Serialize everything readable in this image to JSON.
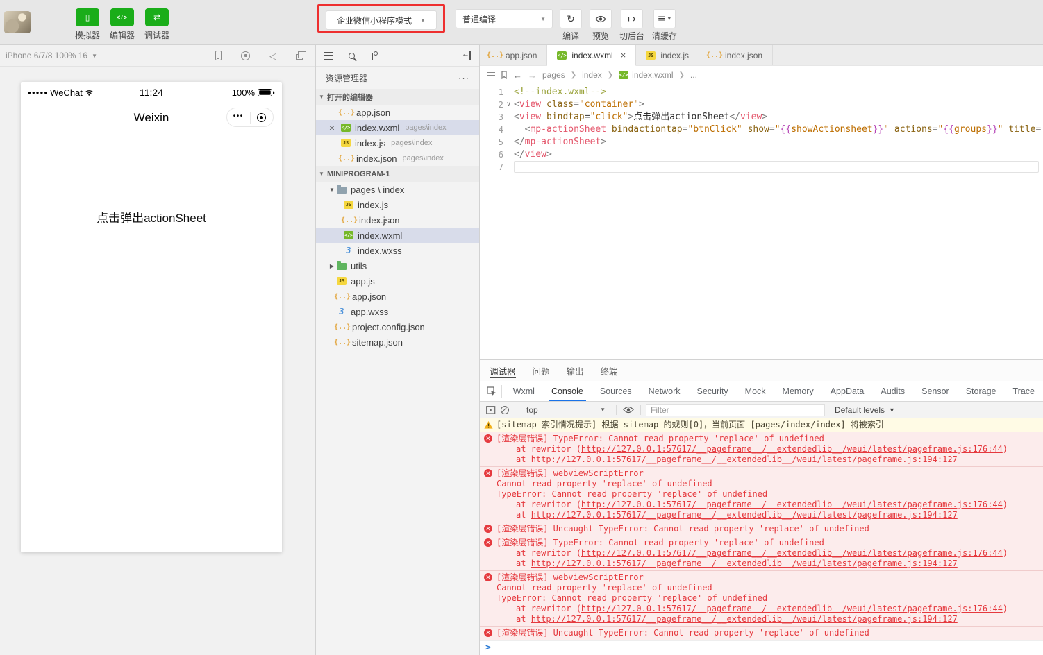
{
  "topbar": {
    "nav": [
      {
        "name": "simulator",
        "label": "模拟器",
        "icon": "phone-icon"
      },
      {
        "name": "editor",
        "label": "编辑器",
        "icon": "code-icon"
      },
      {
        "name": "debugger",
        "label": "调试器",
        "icon": "sliders-icon"
      }
    ],
    "mode_select": {
      "value": "企业微信小程序模式"
    },
    "compile_select": {
      "value": "普通编译"
    },
    "actions": [
      {
        "name": "compile",
        "label": "编译",
        "icon": "refresh-icon",
        "caret": false
      },
      {
        "name": "preview",
        "label": "预览",
        "icon": "eye-icon",
        "caret": false
      },
      {
        "name": "switch-background",
        "label": "切后台",
        "icon": "background-icon",
        "caret": false
      },
      {
        "name": "clear-cache",
        "label": "清缓存",
        "icon": "layers-icon",
        "caret": true
      }
    ]
  },
  "simulator": {
    "device_label": "iPhone 6/7/8 100% 16",
    "toolbar_icons": [
      "rotate-device",
      "record",
      "mute",
      "detach-window"
    ],
    "status": {
      "signal": "●●●●●",
      "carrier": "WeChat",
      "time": "11:24",
      "battery": "100%"
    },
    "nav_title": "Weixin",
    "capsule_dots": "•••",
    "content_text": "点击弹出actionSheet"
  },
  "explorer": {
    "title": "资源管理器",
    "menu_dots": "···",
    "open_editors": {
      "label": "打开的编辑器",
      "items": [
        {
          "icon": "json",
          "name": "app.json",
          "path": ""
        },
        {
          "icon": "wxml",
          "name": "index.wxml",
          "path": "pages\\index",
          "selected": true,
          "closable": true
        },
        {
          "icon": "js",
          "name": "index.js",
          "path": "pages\\index"
        },
        {
          "icon": "json",
          "name": "index.json",
          "path": "pages\\index"
        }
      ]
    },
    "project": {
      "label": "MINIPROGRAM-1",
      "items": [
        {
          "icon": "folder",
          "name": "pages \\ index",
          "depth": 0,
          "arrow": "down"
        },
        {
          "icon": "js",
          "name": "index.js",
          "depth": 1
        },
        {
          "icon": "json",
          "name": "index.json",
          "depth": 1
        },
        {
          "icon": "wxml",
          "name": "index.wxml",
          "depth": 1,
          "selected": true
        },
        {
          "icon": "wxss",
          "name": "index.wxss",
          "depth": 1
        },
        {
          "icon": "folder-green",
          "name": "utils",
          "depth": 0,
          "arrow": "right"
        },
        {
          "icon": "js",
          "name": "app.js",
          "depth": 0
        },
        {
          "icon": "json",
          "name": "app.json",
          "depth": 0
        },
        {
          "icon": "wxss",
          "name": "app.wxss",
          "depth": 0
        },
        {
          "icon": "json",
          "name": "project.config.json",
          "depth": 0
        },
        {
          "icon": "json",
          "name": "sitemap.json",
          "depth": 0
        }
      ]
    }
  },
  "editor": {
    "tabs": [
      {
        "icon": "json",
        "label": "app.json"
      },
      {
        "icon": "wxml",
        "label": "index.wxml",
        "active": true,
        "closable": true
      },
      {
        "icon": "js",
        "label": "index.js"
      },
      {
        "icon": "json",
        "label": "index.json"
      }
    ],
    "breadcrumb": [
      {
        "label": "pages"
      },
      {
        "label": "index"
      },
      {
        "label": "index.wxml",
        "icon": "wxml"
      },
      {
        "label": "..."
      }
    ],
    "code": {
      "lines": [
        {
          "n": "1",
          "tokens": [
            [
              "comment",
              "<!--index.wxml-->"
            ]
          ]
        },
        {
          "n": "2",
          "fold": true,
          "tokens": [
            [
              "br",
              "<"
            ],
            [
              "tag",
              "view"
            ],
            [
              "pl",
              " "
            ],
            [
              "attr",
              "class"
            ],
            [
              "op",
              "="
            ],
            [
              "str",
              "\"container\""
            ],
            [
              "br",
              ">"
            ]
          ]
        },
        {
          "n": "3",
          "tokens": [
            [
              "br",
              "<"
            ],
            [
              "tag",
              "view"
            ],
            [
              "pl",
              " "
            ],
            [
              "attr",
              "bindtap"
            ],
            [
              "op",
              "="
            ],
            [
              "str",
              "\"click\""
            ],
            [
              "br",
              ">"
            ],
            [
              "txt",
              "点击弹出actionSheet"
            ],
            [
              "br",
              "</"
            ],
            [
              "tag",
              "view"
            ],
            [
              "br",
              ">"
            ]
          ]
        },
        {
          "n": "4",
          "tokens": [
            [
              "pl",
              "  "
            ],
            [
              "br",
              "<"
            ],
            [
              "tag",
              "mp-actionSheet"
            ],
            [
              "pl",
              " "
            ],
            [
              "attr",
              "bindactiontap"
            ],
            [
              "op",
              "="
            ],
            [
              "str",
              "\"btnClick\""
            ],
            [
              "pl",
              " "
            ],
            [
              "attr",
              "show"
            ],
            [
              "op",
              "="
            ],
            [
              "str",
              "\""
            ],
            [
              "mu",
              "{{"
            ],
            [
              "muv",
              "showActionsheet"
            ],
            [
              "mu",
              "}}"
            ],
            [
              "str",
              "\""
            ],
            [
              "pl",
              " "
            ],
            [
              "attr",
              "actions"
            ],
            [
              "op",
              "="
            ],
            [
              "str",
              "\""
            ],
            [
              "mu",
              "{{"
            ],
            [
              "muv",
              "groups"
            ],
            [
              "mu",
              "}}"
            ],
            [
              "str",
              "\""
            ],
            [
              "pl",
              " "
            ],
            [
              "attr",
              "title"
            ],
            [
              "op",
              "="
            ]
          ]
        },
        {
          "n": "5",
          "tokens": [
            [
              "br",
              "</"
            ],
            [
              "tag",
              "mp-actionSheet"
            ],
            [
              "br",
              ">"
            ]
          ]
        },
        {
          "n": "6",
          "tokens": [
            [
              "br",
              "</"
            ],
            [
              "tag",
              "view"
            ],
            [
              "br",
              ">"
            ]
          ]
        },
        {
          "n": "7",
          "current": true,
          "tokens": []
        }
      ]
    }
  },
  "debugger": {
    "tabs": [
      {
        "label": "调试器",
        "active": true
      },
      {
        "label": "问题"
      },
      {
        "label": "输出"
      },
      {
        "label": "终端"
      }
    ],
    "devtools_tabs": [
      {
        "label": "Wxml"
      },
      {
        "label": "Console",
        "active": true
      },
      {
        "label": "Sources"
      },
      {
        "label": "Network"
      },
      {
        "label": "Security"
      },
      {
        "label": "Mock"
      },
      {
        "label": "Memory"
      },
      {
        "label": "AppData"
      },
      {
        "label": "Audits"
      },
      {
        "label": "Sensor"
      },
      {
        "label": "Storage"
      },
      {
        "label": "Trace"
      }
    ],
    "console": {
      "toolbar": {
        "context": "top",
        "filter_placeholder": "Filter",
        "levels": "Default levels"
      },
      "prompt": ">",
      "messages": [
        {
          "level": "warning",
          "lines": [
            {
              "type": "head",
              "text": "[sitemap 索引情况提示] 根据 sitemap 的规则[0]，当前页面 [pages/index/index] 将被索引"
            }
          ]
        },
        {
          "level": "error",
          "lines": [
            {
              "type": "head",
              "text": "[渲染层错误] TypeError: Cannot read property 'replace' of undefined"
            },
            {
              "type": "stack",
              "pre": "at rewritor (",
              "link": "http://127.0.0.1:57617/__pageframe__/__extendedlib__/weui/latest/pageframe.js:176:44",
              "suf": ")"
            },
            {
              "type": "stack",
              "pre": "at ",
              "link": "http://127.0.0.1:57617/__pageframe__/__extendedlib__/weui/latest/pageframe.js:194:127",
              "suf": ""
            }
          ]
        },
        {
          "level": "error",
          "lines": [
            {
              "type": "head",
              "text": "[渲染层错误] webviewScriptError"
            },
            {
              "type": "body",
              "text": "Cannot read property 'replace' of undefined"
            },
            {
              "type": "body",
              "text": "TypeError: Cannot read property 'replace' of undefined"
            },
            {
              "type": "stack",
              "pre": "at rewritor (",
              "link": "http://127.0.0.1:57617/__pageframe__/__extendedlib__/weui/latest/pageframe.js:176:44",
              "suf": ")"
            },
            {
              "type": "stack",
              "pre": "at ",
              "link": "http://127.0.0.1:57617/__pageframe__/__extendedlib__/weui/latest/pageframe.js:194:127",
              "suf": ""
            }
          ]
        },
        {
          "level": "error",
          "lines": [
            {
              "type": "head",
              "text": "[渲染层错误] Uncaught TypeError: Cannot read property 'replace' of undefined"
            }
          ]
        },
        {
          "level": "error",
          "lines": [
            {
              "type": "head",
              "text": "[渲染层错误] TypeError: Cannot read property 'replace' of undefined"
            },
            {
              "type": "stack",
              "pre": "at rewritor (",
              "link": "http://127.0.0.1:57617/__pageframe__/__extendedlib__/weui/latest/pageframe.js:176:44",
              "suf": ")"
            },
            {
              "type": "stack",
              "pre": "at ",
              "link": "http://127.0.0.1:57617/__pageframe__/__extendedlib__/weui/latest/pageframe.js:194:127",
              "suf": ""
            }
          ]
        },
        {
          "level": "error",
          "lines": [
            {
              "type": "head",
              "text": "[渲染层错误] webviewScriptError"
            },
            {
              "type": "body",
              "text": "Cannot read property 'replace' of undefined"
            },
            {
              "type": "body",
              "text": "TypeError: Cannot read property 'replace' of undefined"
            },
            {
              "type": "stack",
              "pre": "at rewritor (",
              "link": "http://127.0.0.1:57617/__pageframe__/__extendedlib__/weui/latest/pageframe.js:176:44",
              "suf": ")"
            },
            {
              "type": "stack",
              "pre": "at ",
              "link": "http://127.0.0.1:57617/__pageframe__/__extendedlib__/weui/latest/pageframe.js:194:127",
              "suf": ""
            }
          ]
        },
        {
          "level": "error",
          "lines": [
            {
              "type": "head",
              "text": "[渲染层错误] Uncaught TypeError: Cannot read property 'replace' of undefined"
            }
          ]
        }
      ]
    }
  }
}
